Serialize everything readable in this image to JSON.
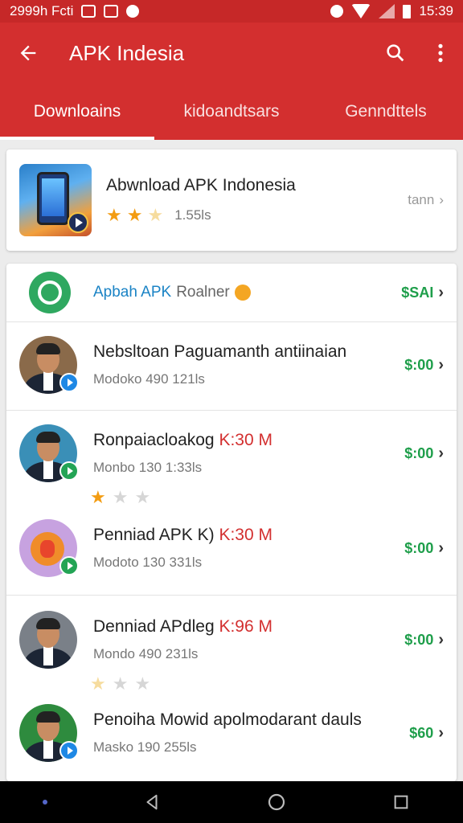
{
  "status_bar": {
    "left_text": "2999h Fcti",
    "time": "15:39"
  },
  "app_bar": {
    "title": "APK Indesia"
  },
  "tabs": [
    {
      "label": "Downloains"
    },
    {
      "label": "kidoandtsars"
    },
    {
      "label": "Genndttels"
    }
  ],
  "featured": {
    "title": "Abwnload APK Indonesia",
    "rating_stars": 2,
    "meta": "1.55ls",
    "right_text": "tann"
  },
  "category": {
    "label": "Apbah APK",
    "sub": "Roalner",
    "price": "$SAI"
  },
  "items": [
    {
      "title": "Nebsltoan Paguamanth antiinaian",
      "size": "",
      "meta": "Modoko 490  121ls",
      "price": "$:00",
      "badge": "blue"
    },
    {
      "title": "Ronpaiacloakog",
      "size": "K:30 M",
      "meta": "Monbo 130  1:33ls",
      "price": "$:00",
      "badge": "green"
    },
    {
      "title": "Penniad APK K)",
      "size": "K:30 M",
      "meta": "Modoto 130  331ls",
      "price": "$:00",
      "badge": "green"
    },
    {
      "title": "Denniad APdleg",
      "size": "K:96 M",
      "meta": "Mondo 490  231ls",
      "price": "$:00",
      "badge": ""
    },
    {
      "title": "Penoiha Mowid apolmodarant dauls",
      "size": "",
      "meta": "Masko 190  255ls",
      "price": "$60",
      "badge": "blue"
    }
  ],
  "colors": {
    "primary": "#d32f2f",
    "price_green": "#1e9e4a",
    "link_blue": "#1a83c5"
  }
}
